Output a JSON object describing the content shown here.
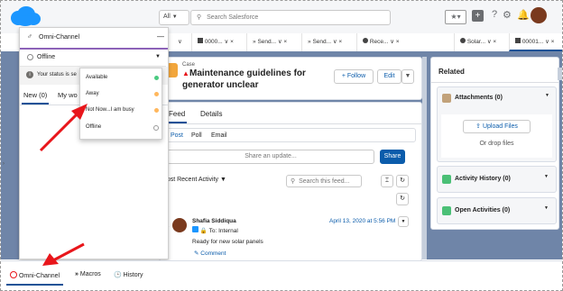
{
  "header": {
    "search_scope": "All",
    "search_placeholder": "Search Salesforce"
  },
  "tabs": [
    {
      "label": "0000...",
      "icon": "case-icon"
    },
    {
      "label": "Send...",
      "icon": "quick-text-icon"
    },
    {
      "label": "Send...",
      "icon": "quick-text-icon"
    },
    {
      "label": "Rece...",
      "icon": "opportunity-icon"
    },
    {
      "label": "Solar...",
      "icon": "opportunity-icon"
    },
    {
      "label": "00001...",
      "icon": "case-icon"
    }
  ],
  "omni": {
    "title": "Omni-Channel",
    "status_value": "Offline",
    "status_message": "Your status is se",
    "tab_new": "New (0)",
    "tab_my": "My wo",
    "dropdown": [
      {
        "label": "Available",
        "color": "#4bca81"
      },
      {
        "label": "Away",
        "color": "#ffb75d"
      },
      {
        "label": "Not Now...I am busy",
        "color": "#ffb75d"
      },
      {
        "label": "Offline",
        "color": "#ffffff"
      }
    ]
  },
  "record": {
    "object": "Case",
    "title_line1": "Maintenance guidelines for",
    "title_line2": "generator unclear",
    "follow": "+ Follow",
    "edit": "Edit"
  },
  "feed": {
    "tab_feed": "Feed",
    "tab_details": "Details",
    "sub_post": "Post",
    "sub_poll": "Poll",
    "sub_email": "Email",
    "share_placeholder": "Share an update...",
    "share_button": "Share",
    "sort_label": "Most Recent Activity",
    "search_placeholder": "Search this feed...",
    "post": {
      "author": "Shafia Siddiqua",
      "date": "April 13, 2020 at 5:56 PM",
      "to": "To: Internal",
      "body": "Ready for new solar panels",
      "comment": "Comment"
    }
  },
  "related": {
    "title": "Related",
    "attachments": "Attachments (0)",
    "upload": "Upload Files",
    "drop": "Or drop files",
    "activity_history": "Activity History (0)",
    "open_activities": "Open Activities (0)"
  },
  "utility": {
    "omni": "Omni-Channel",
    "macros": "Macros",
    "history": "History"
  },
  "colors": {
    "brand": "#1b96ff",
    "arrow": "#e8161b",
    "case_orange": "#f2a63c",
    "activity_green": "#4bc076"
  }
}
